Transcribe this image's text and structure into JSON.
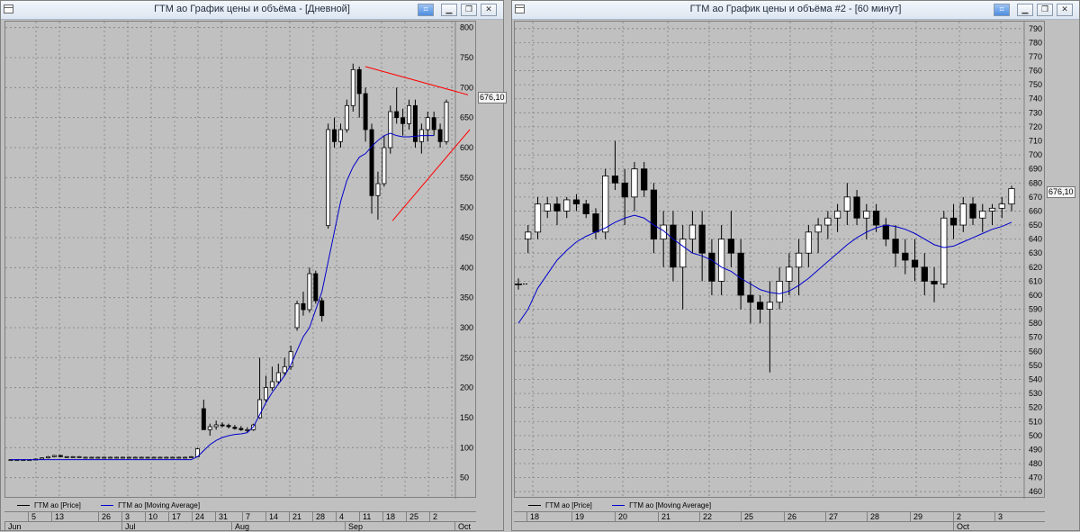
{
  "windows": [
    {
      "title": "ГТМ ао График цены и объёма - [Дневной]",
      "buttons": [
        "pin-icon",
        "minimize-icon",
        "restore-icon",
        "close-icon"
      ],
      "last_price": "676,10",
      "legend": [
        {
          "label": "ГТМ ао [Price]",
          "color": "#000000"
        },
        {
          "label": "ГТМ ао [Moving Average]",
          "color": "#0000cc"
        }
      ],
      "x_day_ticks": [
        "5",
        "13",
        "26",
        "3",
        "10",
        "17",
        "24",
        "31",
        "7",
        "14",
        "21",
        "28",
        "4",
        "11",
        "18",
        "25",
        "2"
      ],
      "x_month_ticks": [
        "Jun",
        "Jul",
        "Aug",
        "Sep",
        "Oct"
      ]
    },
    {
      "title": "ГТМ ао График цены и объёма #2 - [60 минут]",
      "buttons": [
        "pin-icon",
        "minimize-icon",
        "restore-icon",
        "close-icon"
      ],
      "last_price": "676,10",
      "legend": [
        {
          "label": "ГТМ ао [Price]",
          "color": "#000000"
        },
        {
          "label": "ГТМ ао [Moving Average]",
          "color": "#0000cc"
        }
      ],
      "x_day_ticks": [
        "18",
        "19",
        "20",
        "21",
        "22",
        "25",
        "26",
        "27",
        "28",
        "29",
        "2",
        "3"
      ],
      "x_month_ticks": [
        "Oct"
      ]
    }
  ],
  "chart_data": [
    {
      "type": "candlestick",
      "title": "ГТМ ао График цены и объёма - [Дневной]",
      "y_ticks": [
        50,
        100,
        150,
        200,
        250,
        300,
        350,
        400,
        450,
        500,
        550,
        600,
        650,
        700,
        750,
        800
      ],
      "ylim": [
        15,
        810
      ],
      "grid": true,
      "candles": [
        [
          80,
          81,
          79,
          80
        ],
        [
          80,
          81,
          79,
          80
        ],
        [
          80,
          81,
          79,
          80
        ],
        [
          80,
          81,
          79,
          80
        ],
        [
          80,
          82,
          79,
          81
        ],
        [
          81,
          84,
          80,
          83
        ],
        [
          83,
          86,
          82,
          85
        ],
        [
          85,
          88,
          84,
          87
        ],
        [
          87,
          88,
          84,
          85
        ],
        [
          85,
          86,
          84,
          85
        ],
        [
          85,
          86,
          84,
          85
        ],
        [
          85,
          86,
          84,
          85
        ],
        [
          84,
          85,
          83,
          84
        ],
        [
          84,
          85,
          83,
          84
        ],
        [
          84,
          85,
          83,
          84
        ],
        [
          84,
          85,
          83,
          84
        ],
        [
          84,
          85,
          83,
          84
        ],
        [
          84,
          85,
          83,
          84
        ],
        [
          84,
          85,
          83,
          84
        ],
        [
          84,
          85,
          83,
          84
        ],
        [
          84,
          85,
          83,
          84
        ],
        [
          84,
          85,
          83,
          84
        ],
        [
          84,
          85,
          83,
          84
        ],
        [
          84,
          85,
          83,
          84
        ],
        [
          84,
          85,
          83,
          84
        ],
        [
          84,
          85,
          83,
          84
        ],
        [
          84,
          85,
          83,
          84
        ],
        [
          84,
          85,
          83,
          84
        ],
        [
          84,
          85,
          83,
          84
        ],
        [
          84,
          86,
          83,
          85
        ],
        [
          85,
          100,
          84,
          98
        ],
        [
          165,
          180,
          150,
          130
        ],
        [
          130,
          140,
          120,
          135
        ],
        [
          135,
          145,
          130,
          138
        ],
        [
          138,
          142,
          134,
          137
        ],
        [
          137,
          140,
          132,
          135
        ],
        [
          134,
          138,
          130,
          132
        ],
        [
          132,
          136,
          128,
          130
        ],
        [
          130,
          134,
          126,
          130
        ],
        [
          130,
          140,
          128,
          138
        ],
        [
          150,
          250,
          148,
          180
        ],
        [
          180,
          220,
          175,
          200
        ],
        [
          200,
          235,
          195,
          210
        ],
        [
          210,
          240,
          205,
          225
        ],
        [
          225,
          250,
          220,
          235
        ],
        [
          235,
          270,
          230,
          260
        ],
        [
          300,
          345,
          295,
          340
        ],
        [
          340,
          360,
          320,
          330
        ],
        [
          330,
          400,
          325,
          390
        ],
        [
          390,
          395,
          340,
          345
        ],
        [
          345,
          350,
          310,
          320
        ],
        [
          470,
          640,
          465,
          630
        ],
        [
          630,
          650,
          600,
          610
        ],
        [
          610,
          640,
          600,
          630
        ],
        [
          630,
          680,
          625,
          670
        ],
        [
          670,
          740,
          660,
          730
        ],
        [
          730,
          735,
          650,
          690
        ],
        [
          690,
          700,
          610,
          630
        ],
        [
          630,
          640,
          490,
          520
        ],
        [
          520,
          560,
          480,
          540
        ],
        [
          540,
          620,
          535,
          600
        ],
        [
          600,
          670,
          590,
          660
        ],
        [
          660,
          700,
          640,
          650
        ],
        [
          650,
          665,
          620,
          640
        ],
        [
          640,
          680,
          630,
          670
        ],
        [
          670,
          680,
          600,
          610
        ],
        [
          610,
          640,
          590,
          630
        ],
        [
          630,
          660,
          610,
          650
        ],
        [
          650,
          660,
          620,
          630
        ],
        [
          630,
          640,
          600,
          610
        ],
        [
          610,
          680,
          605,
          676
        ]
      ],
      "moving_average": [
        80,
        80,
        80,
        80,
        80,
        80,
        80,
        80,
        80,
        80,
        80,
        80,
        80,
        80,
        80,
        80,
        80,
        80,
        80,
        80,
        80,
        80,
        80,
        80,
        80,
        80,
        80,
        80,
        80,
        80,
        85,
        95,
        105,
        112,
        117,
        120,
        122,
        123,
        125,
        135,
        155,
        175,
        192,
        206,
        220,
        238,
        262,
        285,
        300,
        330,
        360,
        410,
        460,
        510,
        545,
        568,
        584,
        590,
        602,
        612,
        620,
        624,
        620,
        618,
        618,
        619,
        620,
        620,
        620
      ]
    },
    {
      "type": "candlestick",
      "title": "ГТМ ао График цены и объёма #2 - [60 минут]",
      "y_ticks": [
        460,
        470,
        480,
        490,
        500,
        510,
        520,
        530,
        540,
        550,
        560,
        570,
        580,
        590,
        600,
        610,
        620,
        630,
        640,
        650,
        660,
        670,
        680,
        690,
        700,
        710,
        720,
        730,
        740,
        750,
        760,
        770,
        780,
        790
      ],
      "ylim": [
        455,
        795
      ],
      "grid": true,
      "candles": [
        [
          608,
          612,
          604,
          608
        ],
        [
          640,
          650,
          630,
          645
        ],
        [
          645,
          670,
          640,
          665
        ],
        [
          660,
          670,
          655,
          665
        ],
        [
          665,
          670,
          650,
          660
        ],
        [
          660,
          670,
          655,
          668
        ],
        [
          668,
          672,
          660,
          665
        ],
        [
          665,
          668,
          655,
          658
        ],
        [
          658,
          662,
          640,
          645
        ],
        [
          645,
          690,
          640,
          685
        ],
        [
          685,
          710,
          675,
          680
        ],
        [
          680,
          690,
          650,
          670
        ],
        [
          670,
          695,
          660,
          690
        ],
        [
          690,
          695,
          670,
          675
        ],
        [
          675,
          680,
          630,
          640
        ],
        [
          640,
          660,
          620,
          650
        ],
        [
          650,
          660,
          610,
          620
        ],
        [
          620,
          650,
          590,
          640
        ],
        [
          640,
          660,
          630,
          650
        ],
        [
          650,
          660,
          610,
          630
        ],
        [
          630,
          640,
          600,
          610
        ],
        [
          610,
          650,
          600,
          640
        ],
        [
          640,
          660,
          620,
          630
        ],
        [
          630,
          640,
          590,
          600
        ],
        [
          600,
          610,
          580,
          595
        ],
        [
          595,
          600,
          580,
          590
        ],
        [
          590,
          610,
          545,
          595
        ],
        [
          595,
          620,
          590,
          610
        ],
        [
          610,
          630,
          600,
          620
        ],
        [
          620,
          640,
          600,
          630
        ],
        [
          630,
          650,
          620,
          645
        ],
        [
          645,
          655,
          630,
          650
        ],
        [
          650,
          660,
          640,
          655
        ],
        [
          655,
          665,
          645,
          660
        ],
        [
          660,
          680,
          650,
          670
        ],
        [
          670,
          675,
          650,
          655
        ],
        [
          655,
          665,
          640,
          660
        ],
        [
          660,
          665,
          645,
          650
        ],
        [
          650,
          655,
          635,
          640
        ],
        [
          640,
          650,
          620,
          630
        ],
        [
          630,
          640,
          615,
          625
        ],
        [
          625,
          640,
          610,
          620
        ],
        [
          620,
          630,
          600,
          610
        ],
        [
          610,
          620,
          595,
          608
        ],
        [
          608,
          660,
          605,
          655
        ],
        [
          655,
          665,
          640,
          650
        ],
        [
          650,
          670,
          645,
          665
        ],
        [
          665,
          670,
          650,
          655
        ],
        [
          655,
          665,
          645,
          660
        ],
        [
          660,
          665,
          650,
          662
        ],
        [
          662,
          670,
          655,
          665
        ],
        [
          665,
          678,
          660,
          676
        ]
      ],
      "moving_average": [
        580,
        590,
        605,
        615,
        625,
        632,
        638,
        642,
        645,
        648,
        652,
        655,
        657,
        655,
        650,
        646,
        640,
        635,
        630,
        628,
        625,
        620,
        617,
        612,
        608,
        604,
        602,
        601,
        603,
        607,
        612,
        618,
        624,
        630,
        636,
        641,
        645,
        648,
        650,
        649,
        647,
        644,
        640,
        636,
        634,
        635,
        638,
        641,
        644,
        647,
        649,
        652
      ]
    }
  ]
}
